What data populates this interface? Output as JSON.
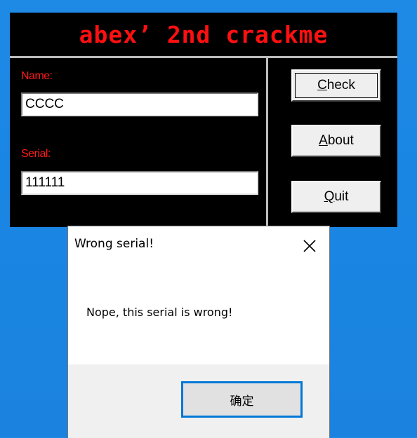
{
  "crackme": {
    "title": "abex’ 2nd crackme",
    "name_label": "Name:",
    "name_value": "CCCC",
    "serial_label": "Serial:",
    "serial_value": "111111",
    "buttons": {
      "check": "Check",
      "about": "About",
      "quit": "Quit"
    },
    "colors": {
      "background": "#000000",
      "title_text": "#ff1010",
      "label_text": "#ff1a1a",
      "divider": "#bdbdbd"
    }
  },
  "message_box": {
    "title": "Wrong serial!",
    "message": "Nope, this serial is wrong!",
    "ok_label": "确定",
    "close_icon": "close-x-icon",
    "colors": {
      "focus_border": "#0078d7",
      "footer": "#f0f0f0"
    }
  },
  "desktop": {
    "background_color": "#1a86e3"
  }
}
